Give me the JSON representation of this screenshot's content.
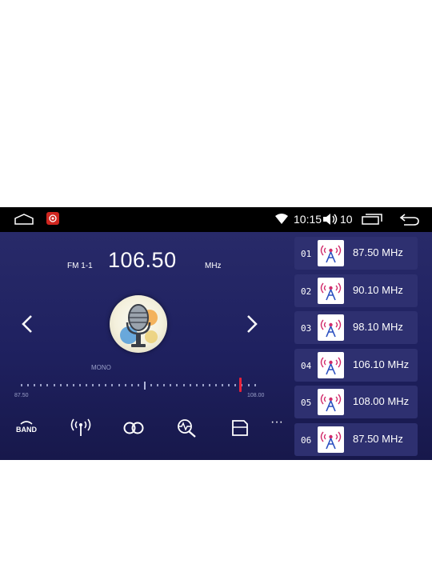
{
  "status_bar": {
    "time": "10:15",
    "volume": "10",
    "icons": [
      "home-icon",
      "app-icon",
      "wifi-icon",
      "volume-icon",
      "recent-apps-icon",
      "back-icon"
    ]
  },
  "radio": {
    "band": "FM 1-1",
    "frequency": "106.50",
    "unit": "MHz",
    "mode": "MONO",
    "range_min": "87.50",
    "range_max": "108.00"
  },
  "controls": [
    "band-icon",
    "dx-antenna-icon",
    "stereo-icon",
    "search-icon",
    "save-icon",
    "more-icon"
  ],
  "more_label": "···",
  "presets": [
    {
      "num": "01",
      "freq": "87.50 MHz"
    },
    {
      "num": "02",
      "freq": "90.10 MHz"
    },
    {
      "num": "03",
      "freq": "98.10 MHz"
    },
    {
      "num": "04",
      "freq": "106.10 MHz"
    },
    {
      "num": "05",
      "freq": "108.00 MHz"
    },
    {
      "num": "06",
      "freq": "87.50 MHz"
    }
  ],
  "colors": {
    "background": "#1f2160",
    "preset_card": "#2e3070",
    "needle": "#e8213a",
    "statusbar": "#000000"
  }
}
